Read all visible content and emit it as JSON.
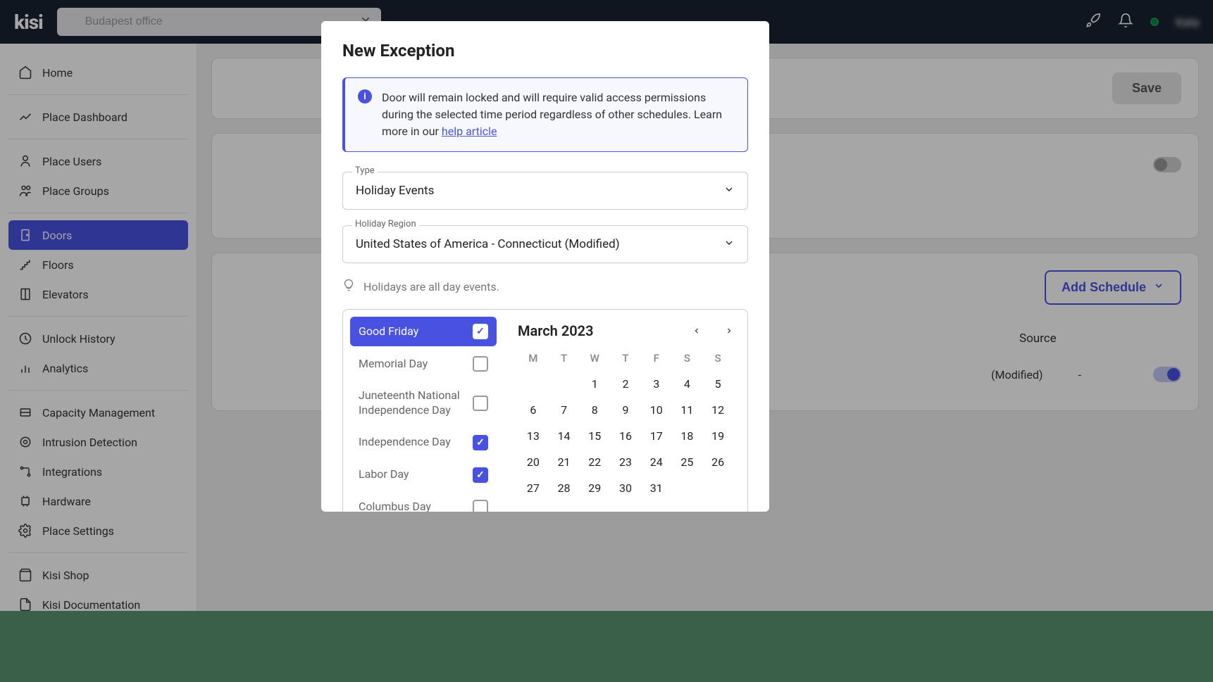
{
  "header": {
    "logo": "kisi",
    "search_value": "Budapest office",
    "user_name": "Kata"
  },
  "sidebar": {
    "items": [
      {
        "label": "Home",
        "icon": "home"
      },
      {
        "label": "Place Dashboard",
        "icon": "dashboard"
      },
      {
        "label": "Place Users",
        "icon": "users"
      },
      {
        "label": "Place Groups",
        "icon": "groups"
      },
      {
        "label": "Doors",
        "icon": "door",
        "active": true
      },
      {
        "label": "Floors",
        "icon": "floor"
      },
      {
        "label": "Elevators",
        "icon": "elevator"
      },
      {
        "label": "Unlock History",
        "icon": "history"
      },
      {
        "label": "Analytics",
        "icon": "analytics"
      },
      {
        "label": "Capacity Management",
        "icon": "capacity"
      },
      {
        "label": "Intrusion Detection",
        "icon": "intrusion"
      },
      {
        "label": "Integrations",
        "icon": "integrations"
      },
      {
        "label": "Hardware",
        "icon": "hardware"
      },
      {
        "label": "Place Settings",
        "icon": "settings"
      },
      {
        "label": "Kisi Shop",
        "icon": "shop"
      },
      {
        "label": "Kisi Documentation",
        "icon": "docs"
      }
    ]
  },
  "main": {
    "save": "Save",
    "add_schedule": "Add Schedule",
    "source_col": "Source",
    "row_modified": "(Modified)",
    "row_dash": "-"
  },
  "modal": {
    "title": "New Exception",
    "info": "Door will remain locked and will require valid access permissions during the selected time period regardless of other schedules. Learn more in our ",
    "info_link": "help article",
    "type_label": "Type",
    "type_value": "Holiday Events",
    "region_label": "Holiday Region",
    "region_value": "United States of America - Connecticut (Modified)",
    "hint": "Holidays are all day events.",
    "holidays": [
      {
        "name": "Good Friday",
        "checked": true,
        "selected": true
      },
      {
        "name": "Memorial Day",
        "checked": false
      },
      {
        "name": "Juneteenth National Independence Day",
        "checked": false
      },
      {
        "name": "Independence Day",
        "checked": true
      },
      {
        "name": "Labor Day",
        "checked": true
      },
      {
        "name": "Columbus Day",
        "checked": false
      }
    ],
    "calendar": {
      "month": "March 2023",
      "dow": [
        "M",
        "T",
        "W",
        "T",
        "F",
        "S",
        "S"
      ],
      "offset": 2,
      "days": 31
    }
  }
}
